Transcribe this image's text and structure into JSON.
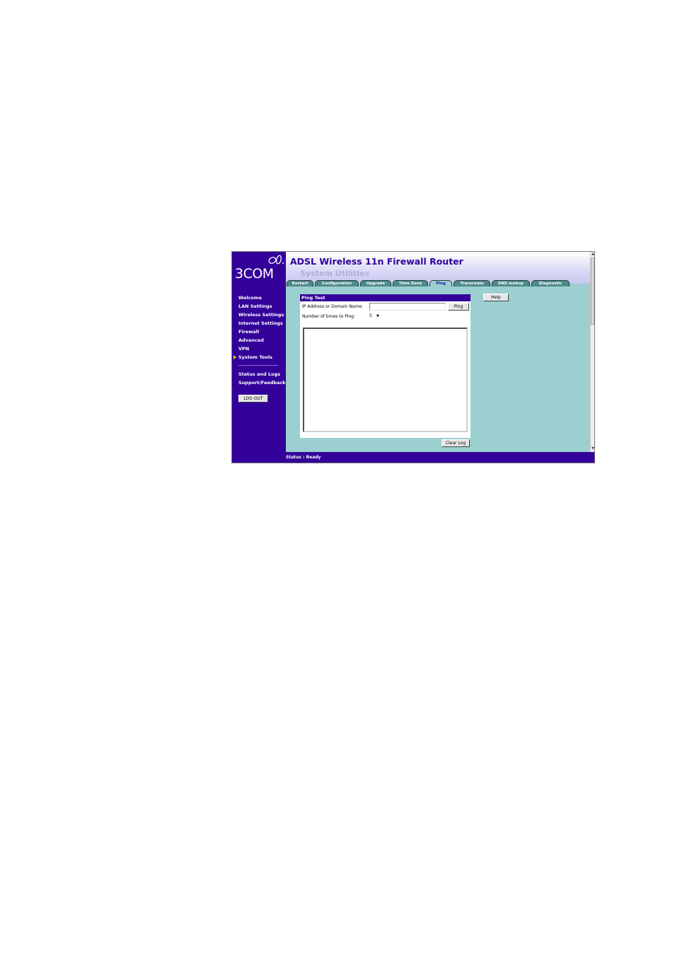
{
  "brand": {
    "logo_text": "3COM"
  },
  "header": {
    "app_title": "ADSL Wireless 11n Firewall Router",
    "page_subtitle": "System Utilities"
  },
  "tabs": [
    {
      "label": "Restart"
    },
    {
      "label": "Configuration"
    },
    {
      "label": "Upgrade"
    },
    {
      "label": "Time Zone"
    },
    {
      "label": "Ping",
      "active": true
    },
    {
      "label": "Traceroute"
    },
    {
      "label": "DNS lookup"
    },
    {
      "label": "Diagnostic"
    }
  ],
  "sidebar": {
    "items": [
      {
        "label": "Welcome"
      },
      {
        "label": "LAN Settings"
      },
      {
        "label": "Wireless Settings"
      },
      {
        "label": "Internet Settings"
      },
      {
        "label": "Firewall"
      },
      {
        "label": "Advanced"
      },
      {
        "label": "VPN"
      },
      {
        "label": "System Tools",
        "active": true
      },
      {
        "label": "Status and Logs"
      },
      {
        "label": "Support/Feedback"
      }
    ],
    "logout_label": "LOG OUT"
  },
  "ping_test": {
    "title": "Ping Test",
    "ip_label": "IP Address or Domain Name:",
    "ip_value": "",
    "ping_button": "Ping",
    "count_label": "Number of times to Ping:",
    "count_value": "5",
    "log_text": "",
    "clear_log_button": "Clear Log"
  },
  "help_button": "Help",
  "status": {
    "text": "Status : Ready"
  },
  "colors": {
    "sidebar_bg": "#33009a",
    "content_bg": "#9ccfcf",
    "tab_bg": "#4f8a8a",
    "subtitle": "#b2acdd"
  }
}
